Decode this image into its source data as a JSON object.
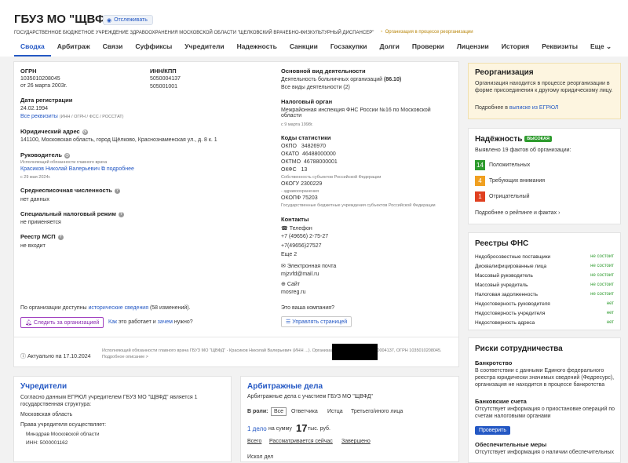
{
  "header": {
    "title": "ГБУЗ МО \"ЩВФД\"",
    "follow": "Отслеживать",
    "fullname": "ГОСУДАРСТВЕННОЕ БЮДЖЕТНОЕ УЧРЕЖДЕНИЕ ЗДРАВООХРАНЕНИЯ МОСКОВСКОЙ ОБЛАСТИ \"ЩЕЛКОВСКИЙ ВРАЧЕБНО-ФИЗКУЛЬТУРНЫЙ ДИСПАНСЕР\"",
    "reorg_note": "Организация в процессе реорганизации"
  },
  "tabs": [
    "Сводка",
    "Арбитраж",
    "Связи",
    "Суффиксы",
    "Учредители",
    "Надежность",
    "Санкции",
    "Госзакупки",
    "Долги",
    "Проверки",
    "Лицензии",
    "История",
    "Реквизиты",
    "Еще"
  ],
  "main": {
    "ogrn_label": "ОГРН",
    "ogrn": "1035010208045",
    "ogrn_date": "от 26 марта 2003г.",
    "inn_label": "ИНН/КПП",
    "inn": "5050004137",
    "kpp": "505001001",
    "reg_label": "Дата регистрации",
    "reg_date": "24.02.1994",
    "all_req": "Все реквизиты",
    "req_codes": "(ИНН / ОГРН / ФСС / РОССТАТ)",
    "addr_label": "Юридический адрес",
    "addr": "141100, Московская область, город Щёлково, Краснознаменская ул., д. 8 к. 1",
    "head_label": "Руководитель",
    "head_role": "Исполняющий обязанности главного врача",
    "head_name": "Красиков Николай Валерьевич",
    "head_more": "подробнее",
    "head_since": "с 29 мая 2024г.",
    "staff_label": "Среднесписочная численность",
    "staff": "нет данных",
    "tax_label": "Специальный налоговый режим",
    "tax": "не применяется",
    "msp_label": "Реестр МСП",
    "msp": "не входит",
    "activity_label": "Основной вид деятельности",
    "activity": "Деятельность больничных организаций",
    "activity_code": "(86.10)",
    "activity_all": "Все виды деятельности (2)",
    "tax_org_label": "Налоговый орган",
    "tax_org": "Межрайонная инспекция ФНС России №16 по Московской области",
    "tax_org_since": "с 9 марта 1998г.",
    "stat_label": "Коды статистики",
    "stat": [
      {
        "k": "ОКПО",
        "v": "34826970"
      },
      {
        "k": "ОКАТО",
        "v": "46488000000"
      },
      {
        "k": "ОКТМО",
        "v": "46788000001"
      },
      {
        "k": "ОКФС",
        "v": "13"
      }
    ],
    "okfs_desc": "Собственность субъектов Российской Федерации",
    "okogu": "ОКОГУ   2300229",
    "okogu_desc": "- здравоохранения",
    "okopf": "ОКОПФ  75203",
    "okopf_desc": "Государственные бюджетные учреждения субъектов Российской Федерации",
    "contacts_label": "Контакты",
    "phone_label": "Телефон",
    "phone1": "+7 (49656) 2-75-27",
    "phone2": "+7(49656)27527",
    "phone_more": "Еще 2",
    "email_label": "Электронная почта",
    "email": "mjzvfd@mail.ru",
    "site_label": "Сайт",
    "site": "mosreg.ru",
    "history_pre": "По организации доступны ",
    "history_link": "исторические сведения",
    "history_post": " (58 изменений).",
    "follow_org": "Следить за организацией",
    "how_pre": "Как",
    "how_mid": " это работает и ",
    "why": "зачем",
    "how_post": " нужно?",
    "your_company": "Это ваша компания?",
    "manage": "Управлять страницей",
    "actual": "Актуально на 17.10.2024",
    "footer_note": "Исполняющий обязанности главного врача ГБУЗ МО \"ЩВФД\" - Красиков Николай Валерьевич (ИНН ...). Организации присвоен ИНН 5050004137, ОГРН 1035010208045. Подробное описание >"
  },
  "reorg": {
    "title": "Реорганизация",
    "text": "Организация находится в процессе реорганизации в форме присоединения к другому юридическому лицу.",
    "more_pre": "Подробнее в ",
    "more_link": "выписке из ЕГРЮЛ"
  },
  "reliability": {
    "title": "Надёжность",
    "level": "ВЫСОКАЯ",
    "found": "Выявлено 19 фактов об организации:",
    "facts": [
      {
        "n": "14",
        "label": "Положительных",
        "color": "#2e9b2e"
      },
      {
        "n": "4",
        "label": "Требующих внимания",
        "color": "#f0a020"
      },
      {
        "n": "1",
        "label": "Отрицательный",
        "color": "#e04020"
      }
    ],
    "more": "Подробнее о рейтинге и фактах"
  },
  "fns": {
    "title": "Реестры ФНС",
    "rows": [
      {
        "k": "Недобросовестные поставщики",
        "v": "не состоит"
      },
      {
        "k": "Дисквалифицированные лица",
        "v": "не состоит"
      },
      {
        "k": "Массовый руководитель",
        "v": "не состоит"
      },
      {
        "k": "Массовый учредитель",
        "v": "не состоит"
      },
      {
        "k": "Налоговая задолженность",
        "v": "не состоит"
      },
      {
        "k": "Недостоверность руководителя",
        "v": "нет"
      },
      {
        "k": "Недостоверность учредителя",
        "v": "нет"
      },
      {
        "k": "Недостоверность адреса",
        "v": "нет"
      }
    ]
  },
  "risks": {
    "title": "Риски сотрудничества",
    "bankrupt_label": "Банкротство",
    "bankrupt_text": "В соответствии с данными Единого федерального реестра юридически значимых сведений (Федресурс), организация не находится в процессе банкротства",
    "bank_label": "Банковские счета",
    "bank_text": "Отсутствует информация о приостановке операций по счетам налоговыми органами",
    "check": "Проверить",
    "other_label": "Обеспечительные меры",
    "other_text": "Отсутствует информация о наличии обеспечительных"
  },
  "founders": {
    "title": "Учредители",
    "text": "Согласно данным ЕГРЮЛ учредителем ГБУЗ МО \"ЩВФД\" является 1 государственная структура:",
    "region": "Московская область",
    "rights": "Права учредителя осуществляет:",
    "org": "Минздрав Московской области",
    "inn": "ИНН: 5000001162"
  },
  "arbitr": {
    "title": "Арбитражные дела",
    "sub": "Арбитражные дела с участием ГБУЗ МО \"ЩВФД\"",
    "role_label": "В роли:",
    "roles": [
      "Все",
      "Ответчика",
      "Истца",
      "Третьего/иного лица"
    ],
    "cases": "1 дело",
    "sum_pre": "на сумму",
    "sum": "17",
    "sum_unit": "тыс. руб.",
    "all": "Всего",
    "now": "Рассматривается сейчас",
    "done": "Завершено",
    "next": "Искол дел"
  }
}
